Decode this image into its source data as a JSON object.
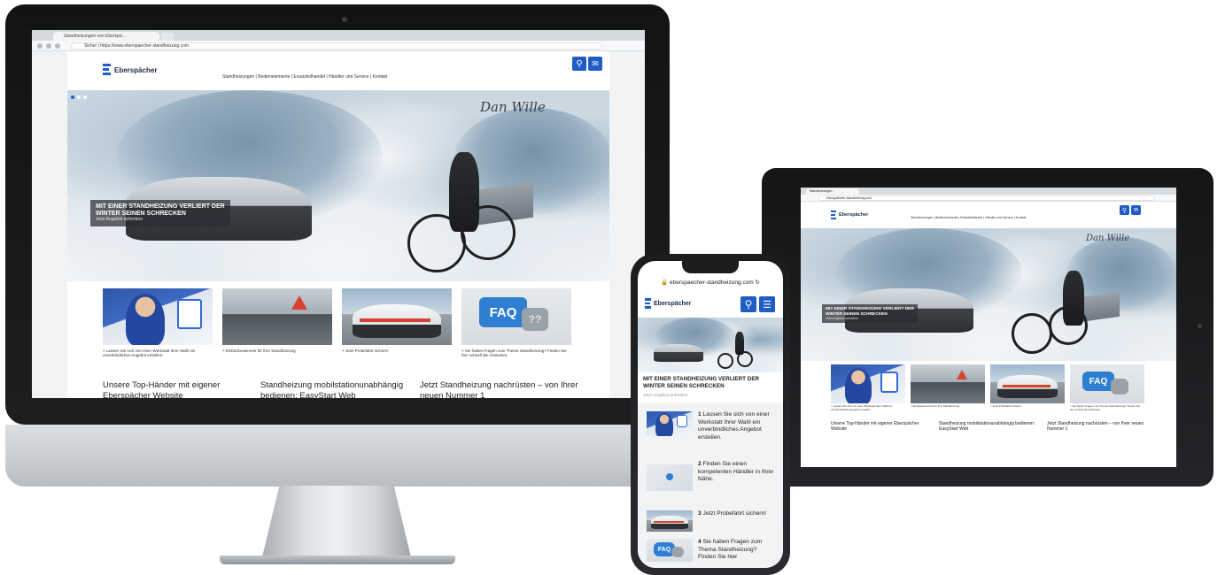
{
  "desktop": {
    "browser": {
      "tab_title": "Standheizungen von Eberspä...",
      "url": "Sicher | https://www.eberspaecher-standheizung.com"
    },
    "logo_text": "Eberspächer",
    "topnav": "Standheizungen | Bedienelemente | Ersatzteilhandel | Händler und Service | Kontakt",
    "hero": {
      "headline_line1": "MIT EINER STANDHEIZUNG VERLIERT DER",
      "headline_line2": "WINTER SEINEN SCHRECKEN",
      "subline": "Jetzt Angebot anfordern",
      "signature": "Dan Wille"
    },
    "cards": [
      {
        "caption": "> Lassen Sie sich von einer Werkstatt Ihrer Wahl ein unverbindliches Angebot erstellen."
      },
      {
        "caption": "> Einbaskostenrest für Ihre Standheizung"
      },
      {
        "caption": "> Jetzt Probefahrt sichern!"
      },
      {
        "caption": "> Sie haben Fragen zum Thema Standheizung? Finden Sie hier schnell die Antworten."
      }
    ],
    "faq_label": "FAQ",
    "faq_marks": "??",
    "teasers": [
      {
        "title": "Unsere Top-Händer mit eigener Eberspächer Website"
      },
      {
        "title": "Standheizung mobilstationunabhängig bedienen: EasyStart Web"
      },
      {
        "title": "Jetzt Standheizung nachrüsten – von Ihrer neuen Nummer 1"
      }
    ]
  },
  "tablet": {
    "browser": {
      "tab_title": "Standheizungen...",
      "url": "eberspaecher-standheizung.com"
    },
    "logo_text": "Eberspächer",
    "topnav": "Standheizungen | Bedienelemente | Ersatzteilhandel | Händler und Service | Kontakt",
    "hero": {
      "headline_line1": "MIT EINER STANDHEIZUNG VERLIERT DER",
      "headline_line2": "WINTER SEINEN SCHRECKEN",
      "subline": "Jetzt Angebot anfordern",
      "signature": "Dan Wille"
    },
    "cards": [
      {
        "caption": "> Lassen Sie sich von einer Werkstatt Ihrer Wahl ein unverbindliches Angebot erstellen."
      },
      {
        "caption": "> Einbaskostenrest für Ihre Standheizung"
      },
      {
        "caption": "> Jetzt Probefahrt sichern!"
      },
      {
        "caption": "> Sie haben Fragen zum Thema Standheizung? Finden Sie hier schnell die Antworten."
      }
    ],
    "faq_label": "FAQ",
    "teasers": [
      {
        "title": "Unsere Top-Händer mit eigener Eberspächer Website"
      },
      {
        "title": "Standheizung mobilstationunabhängig bedienen: EasyStart Web"
      },
      {
        "title": "Jetzt Standheizung nachrüsten – von Ihrer neuen Nummer 1"
      }
    ]
  },
  "phone": {
    "url": "eberspaecher-standheizung.com",
    "logo_text": "Eberspächer",
    "hero": {
      "headline_line1": "MIT EINER STANDHEIZUNG VERLIERT DER",
      "headline_line2": "WINTER SEINEN SCHRECKEN",
      "subline": "Jetzt Angebot anfordern"
    },
    "list": [
      {
        "num": "1",
        "text": "Lassen Sie sich von einer Werkstatt Ihrer Wahl ein unverbindliches Angebot erstellen."
      },
      {
        "num": "2",
        "text": "Finden Sie einen kompetenten Händler in Ihrer Nähe."
      },
      {
        "num": "3",
        "text": "Jetzt Probefahrt sichern!"
      },
      {
        "num": "4",
        "text": "Sie haben Fragen zum Thema Standheizung? Finden Sie hier"
      }
    ],
    "faq_label": "FAQ"
  },
  "colors": {
    "brand_blue": "#1f5cc4",
    "faq_blue": "#2e7fd1"
  },
  "icons": [
    "search-icon",
    "menu-icon",
    "mail-icon",
    "reload-icon",
    "lock-icon"
  ]
}
